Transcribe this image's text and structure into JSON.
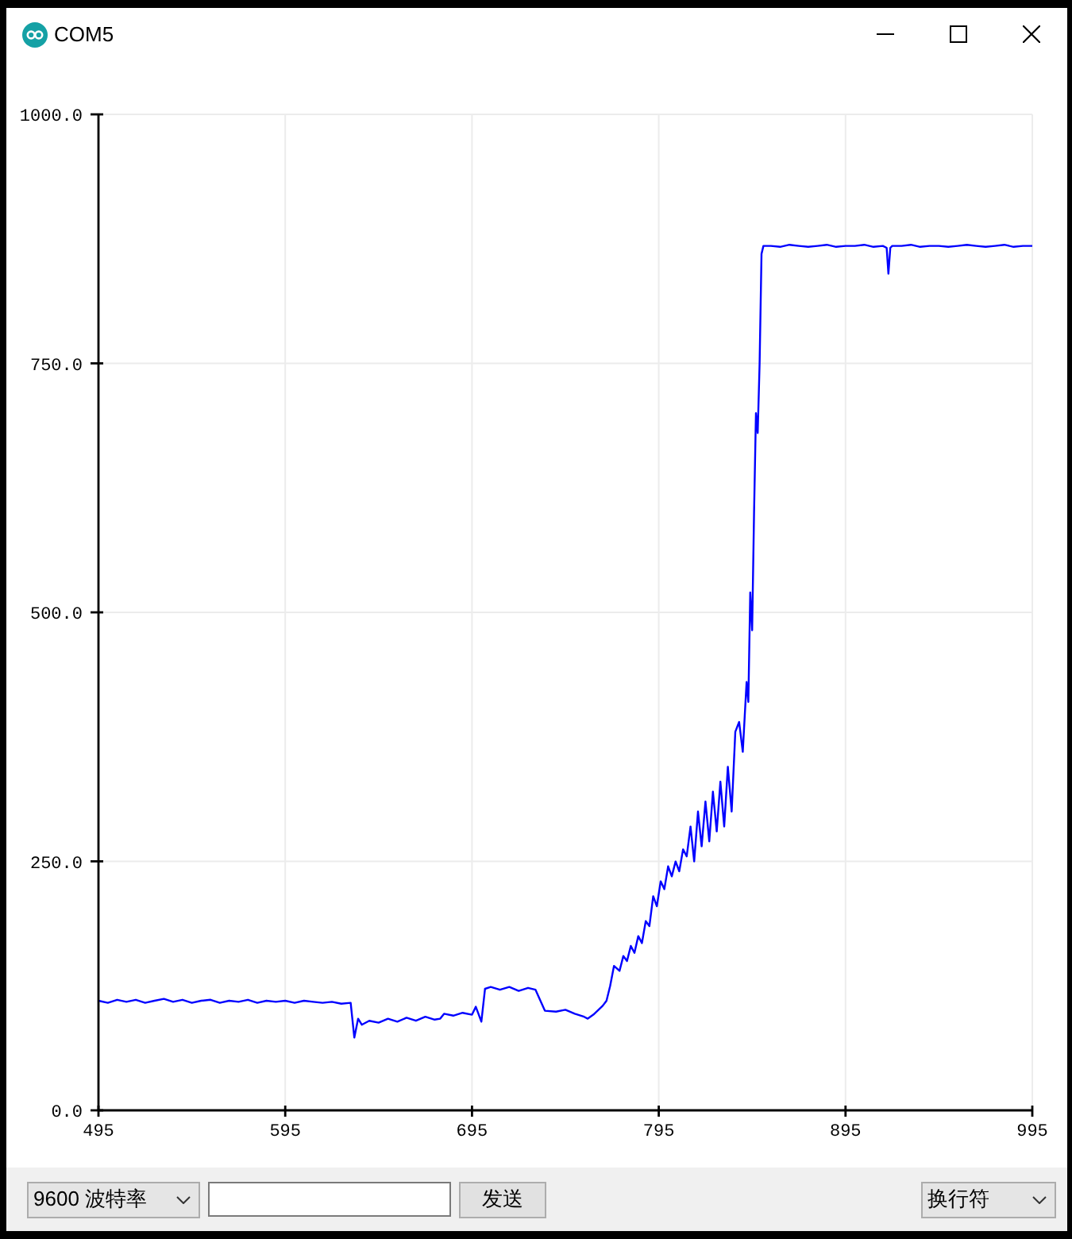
{
  "window": {
    "title": "COM5"
  },
  "plot": {
    "chart_data": {
      "type": "line",
      "grid": true,
      "x": [
        495,
        500,
        505,
        510,
        515,
        520,
        525,
        530,
        535,
        540,
        545,
        550,
        555,
        560,
        565,
        570,
        575,
        580,
        585,
        590,
        595,
        600,
        605,
        610,
        615,
        620,
        625,
        630,
        632,
        634,
        636,
        640,
        645,
        650,
        655,
        660,
        665,
        670,
        675,
        678,
        680,
        685,
        690,
        695,
        697,
        700,
        702,
        705,
        710,
        715,
        720,
        725,
        729,
        734,
        740,
        745,
        750,
        755,
        757,
        760,
        765,
        767,
        769,
        771,
        774,
        776,
        778,
        780,
        782,
        784,
        786,
        788,
        790,
        792,
        794,
        796,
        798,
        800,
        802,
        804,
        806,
        808,
        810,
        812,
        814,
        816,
        818,
        820,
        822,
        824,
        826,
        828,
        830,
        832,
        834,
        836,
        838,
        840,
        842,
        843,
        844,
        845,
        846,
        847,
        848,
        849,
        850,
        851,
        855,
        860,
        865,
        870,
        875,
        880,
        885,
        890,
        895,
        900,
        905,
        910,
        915,
        917,
        918,
        919,
        920,
        925,
        930,
        935,
        940,
        945,
        950,
        955,
        960,
        965,
        970,
        975,
        980,
        985,
        990,
        995
      ],
      "series": [
        {
          "color": "#0000ff",
          "values": [
            110,
            108,
            111,
            109,
            111,
            108,
            110,
            112,
            109,
            111,
            108,
            110,
            111,
            108,
            110,
            109,
            111,
            108,
            110,
            109,
            110,
            108,
            110,
            109,
            108,
            109,
            107,
            108,
            73,
            92,
            86,
            90,
            88,
            92,
            89,
            93,
            90,
            94,
            91,
            92,
            97,
            95,
            98,
            96,
            104,
            89,
            122,
            124,
            121,
            124,
            120,
            123,
            121,
            100,
            99,
            101,
            97,
            94,
            92,
            96,
            105,
            110,
            125,
            145,
            140,
            155,
            150,
            165,
            158,
            175,
            168,
            190,
            185,
            215,
            205,
            230,
            222,
            245,
            235,
            250,
            240,
            262,
            255,
            285,
            250,
            300,
            265,
            310,
            270,
            320,
            280,
            330,
            285,
            345,
            300,
            380,
            390,
            360,
            430,
            410,
            520,
            482,
            600,
            700,
            680,
            750,
            860,
            868,
            868,
            867,
            869,
            868,
            867,
            868,
            869,
            867,
            868,
            868,
            869,
            867,
            868,
            866,
            840,
            866,
            868,
            868,
            869,
            867,
            868,
            868,
            867,
            868,
            869,
            868,
            867,
            868,
            869,
            867,
            868,
            868
          ]
        }
      ],
      "xlim": [
        495,
        995
      ],
      "ylim": [
        0,
        1000
      ],
      "xticks": [
        495,
        595,
        695,
        795,
        895,
        995
      ],
      "yticks": [
        {
          "value": 0,
          "label": "0.0"
        },
        {
          "value": 250,
          "label": "250.0"
        },
        {
          "value": 500,
          "label": "500.0"
        },
        {
          "value": 750,
          "label": "750.0"
        },
        {
          "value": 1000,
          "label": "1000.0"
        }
      ]
    }
  },
  "toolbar": {
    "baud_rate": "9600 波特率",
    "send_button": "发送",
    "line_ending": "换行符"
  }
}
